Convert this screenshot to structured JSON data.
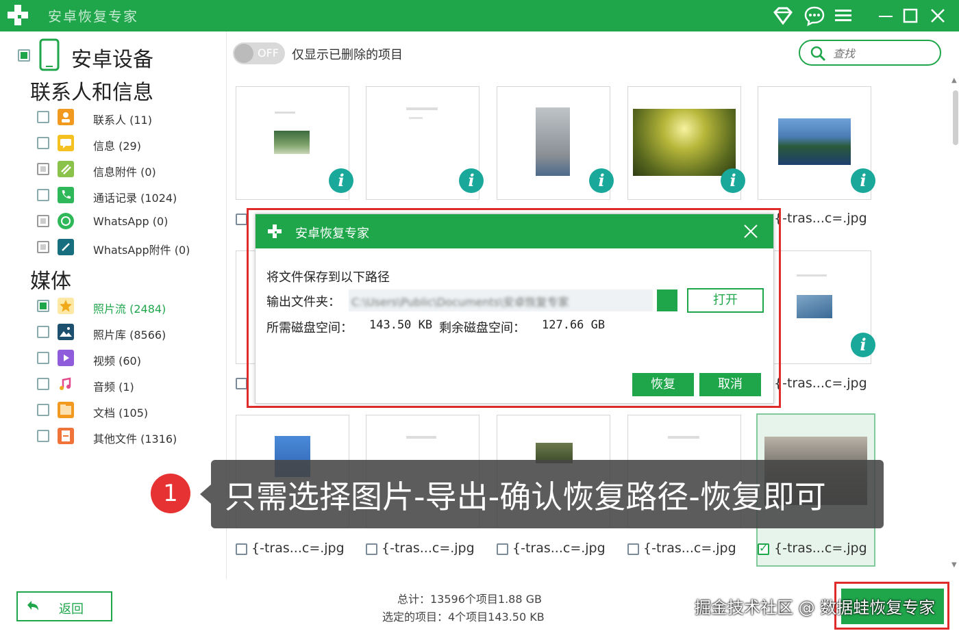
{
  "app": {
    "title": "安卓恢复专家",
    "colors": {
      "brand": "#1fa64b",
      "accent_red": "#e02b2b",
      "info_badge": "#1aa89a"
    }
  },
  "sidebar": {
    "device_title": "安卓设备",
    "sections": [
      {
        "title": "联系人和信息",
        "items": [
          {
            "label": "联系人 (11)",
            "icon": "contacts-icon",
            "state": "unchecked"
          },
          {
            "label": "信息 (29)",
            "icon": "messages-icon",
            "state": "unchecked"
          },
          {
            "label": "信息附件 (0)",
            "icon": "attachment-icon",
            "state": "disabled"
          },
          {
            "label": "通话记录 (1024)",
            "icon": "phone-icon",
            "state": "unchecked"
          },
          {
            "label": "WhatsApp (0)",
            "icon": "whatsapp-icon",
            "state": "disabled"
          },
          {
            "label": "WhatsApp附件 (0)",
            "icon": "whatsapp-attachment-icon",
            "state": "disabled"
          }
        ]
      },
      {
        "title": "媒体",
        "items": [
          {
            "label": "照片流 (2484)",
            "icon": "star-icon",
            "state": "partial"
          },
          {
            "label": "照片库 (8566)",
            "icon": "photo-icon",
            "state": "unchecked"
          },
          {
            "label": "视频 (60)",
            "icon": "video-icon",
            "state": "unchecked"
          },
          {
            "label": "音频 (1)",
            "icon": "audio-icon",
            "state": "unchecked"
          },
          {
            "label": "文档 (105)",
            "icon": "document-icon",
            "state": "unchecked"
          },
          {
            "label": "其他文件 (1316)",
            "icon": "other-file-icon",
            "state": "unchecked"
          }
        ]
      }
    ]
  },
  "filter": {
    "toggle_state": "OFF",
    "label": "仅显示已删除的项目",
    "search_placeholder": "查找"
  },
  "grid": {
    "file_name": "{-tras...c=.jpg",
    "info_glyph": "i",
    "selected_count_visible": 1
  },
  "dialog": {
    "title": "安卓恢复专家",
    "heading": "将文件保存到以下路径",
    "folder_label": "输出文件夹：",
    "folder_value": "C:\\Users\\Public\\Documents\\安卓恢复专家",
    "open_button": "打开",
    "required_label": "所需磁盘空间：",
    "required_value": "143.50 KB",
    "free_label": "剩余磁盘空间：",
    "free_value": "127.66 GB",
    "recover_button": "恢复",
    "cancel_button": "取消"
  },
  "caption": {
    "step": "1",
    "text": "只需选择图片-导出-确认恢复路径-恢复即可"
  },
  "footer": {
    "back_button": "返回",
    "total": "总计：13596个项目1.88 GB",
    "selected": "选定的项目：4个项目143.50 KB",
    "watermark": "掘金技术社区 @ 数据蛙恢复专家"
  }
}
